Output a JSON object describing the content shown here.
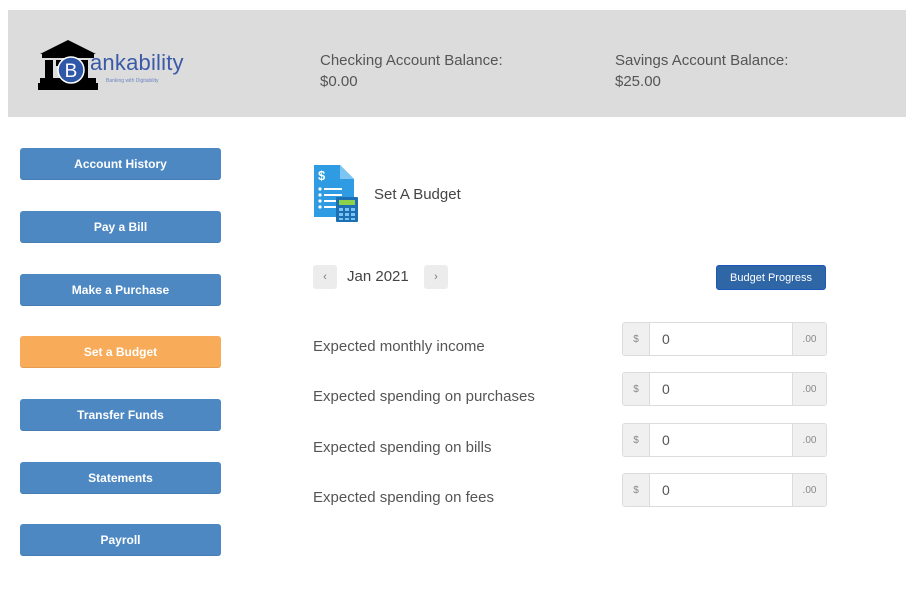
{
  "brand": {
    "name": "ankability",
    "initial": "B",
    "tagline": "Banking with Digitability",
    "color": "#3a5aa8"
  },
  "header": {
    "checking": {
      "label": "Checking Account Balance:",
      "value": "$0.00"
    },
    "savings": {
      "label": "Savings Account Balance:",
      "value": "$25.00"
    }
  },
  "sidebar": {
    "items": [
      {
        "label": "Account History",
        "active": false
      },
      {
        "label": "Pay a Bill",
        "active": false
      },
      {
        "label": "Make a Purchase",
        "active": false
      },
      {
        "label": "Set a Budget",
        "active": true
      },
      {
        "label": "Transfer Funds",
        "active": false
      },
      {
        "label": "Statements",
        "active": false
      },
      {
        "label": "Payroll",
        "active": false
      }
    ],
    "color": "#4d88c2",
    "active_color": "#f8ab59"
  },
  "main": {
    "title": "Set A Budget",
    "icon": "budget-calculator-icon",
    "month_nav": {
      "prev": "‹",
      "current": "Jan 2021",
      "next": "›"
    },
    "progress_button": "Budget Progress",
    "fields": [
      {
        "label": "Expected monthly income",
        "prefix": "$",
        "value": "0",
        "suffix": ".00"
      },
      {
        "label": "Expected spending on purchases",
        "prefix": "$",
        "value": "0",
        "suffix": ".00"
      },
      {
        "label": "Expected spending on bills",
        "prefix": "$",
        "value": "0",
        "suffix": ".00"
      },
      {
        "label": "Expected spending on fees",
        "prefix": "$",
        "value": "0",
        "suffix": ".00"
      }
    ]
  }
}
